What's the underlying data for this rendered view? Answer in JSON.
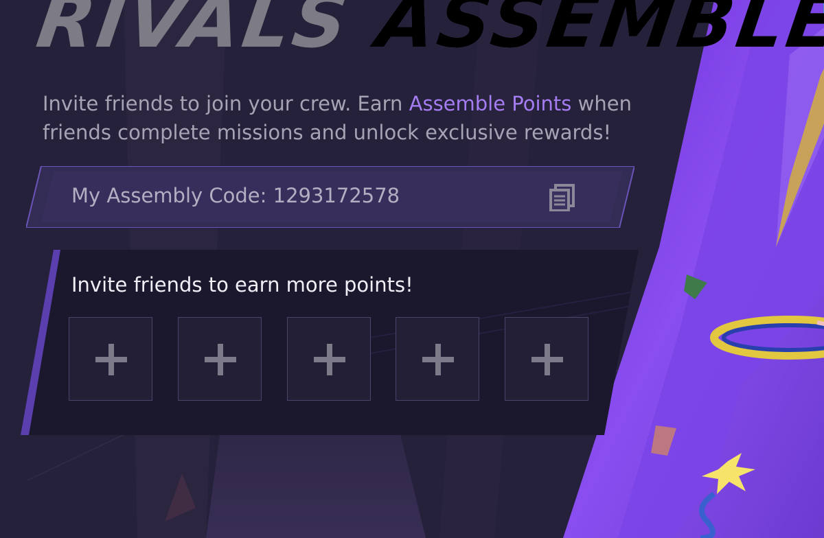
{
  "title": {
    "part1": "RIVALS ",
    "part2": "ASSEMBLE!"
  },
  "intro": {
    "before": "Invite friends to join your crew. Earn ",
    "highlight": "Assemble Points",
    "after": " when friends complete missions and unlock exclusive rewards!"
  },
  "code_panel": {
    "label": "My Assembly Code: 1293172578",
    "copy_icon": "copy-icon"
  },
  "invite_panel": {
    "title": "Invite friends to earn more points!",
    "slots": [
      {
        "icon": "plus-icon"
      },
      {
        "icon": "plus-icon"
      },
      {
        "icon": "plus-icon"
      },
      {
        "icon": "plus-icon"
      },
      {
        "icon": "plus-icon"
      }
    ]
  },
  "colors": {
    "background": "#26213a",
    "accent": "#a57df2",
    "panel": "#1c1930",
    "purple_art": "#7b3fe0"
  }
}
